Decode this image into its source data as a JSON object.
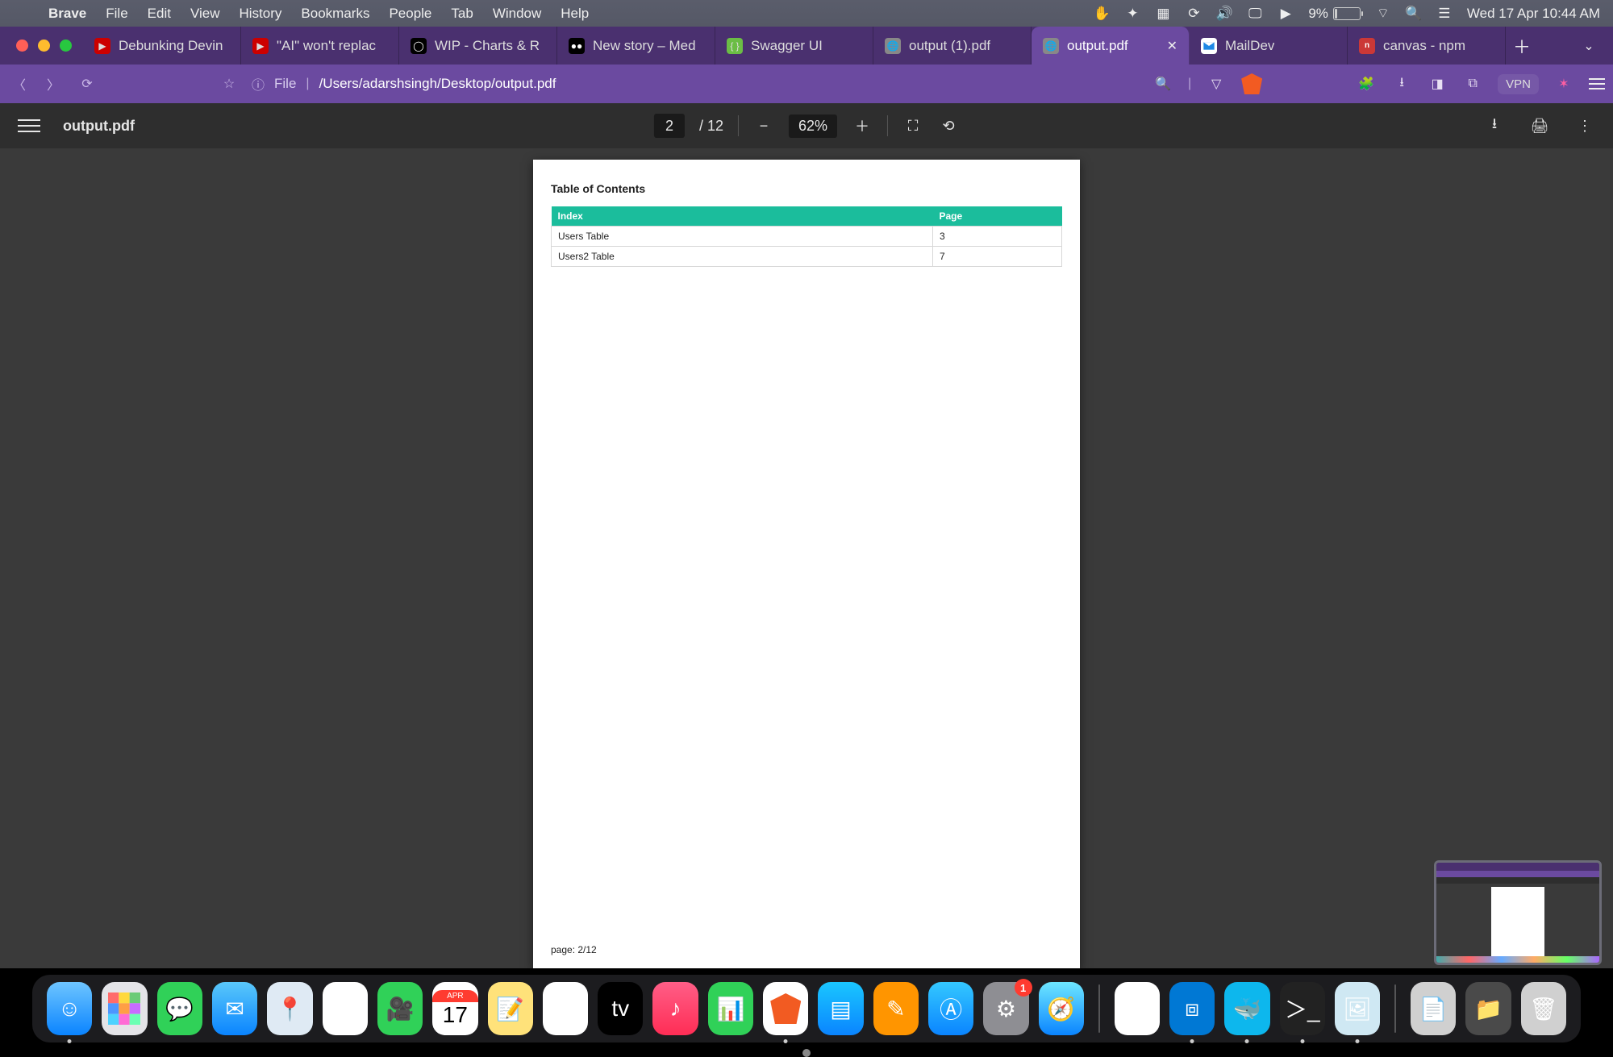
{
  "menubar": {
    "apple": "",
    "app": "Brave",
    "items": [
      "File",
      "Edit",
      "View",
      "History",
      "Bookmarks",
      "People",
      "Tab",
      "Window",
      "Help"
    ],
    "battery_pct": "9%",
    "clock": "Wed 17 Apr  10:44 AM"
  },
  "tabs": [
    {
      "label": "Debunking Devin",
      "favicon": "f-yt"
    },
    {
      "label": "\"AI\" won't replac",
      "favicon": "f-yt"
    },
    {
      "label": "WIP - Charts & R",
      "favicon": "f-gh"
    },
    {
      "label": "New story – Med",
      "favicon": "f-md"
    },
    {
      "label": "Swagger UI",
      "favicon": "f-sw"
    },
    {
      "label": "output (1).pdf",
      "favicon": "f-gl"
    },
    {
      "label": "output.pdf",
      "favicon": "f-gl",
      "active": true
    },
    {
      "label": "MailDev",
      "favicon": "f-ml"
    },
    {
      "label": "canvas - npm",
      "favicon": "f-np"
    }
  ],
  "url": {
    "proto": "File",
    "path": "/Users/adarshsingh/Desktop/output.pdf"
  },
  "vpn_label": "VPN",
  "pdf": {
    "filename": "output.pdf",
    "page_current": "2",
    "page_sep": "/",
    "page_total": "12",
    "zoom": "62%"
  },
  "document": {
    "heading": "Table of Contents",
    "columns": [
      "Index",
      "Page"
    ],
    "rows": [
      {
        "index": "Users Table",
        "page": "3"
      },
      {
        "index": "Users2 Table",
        "page": "7"
      }
    ],
    "footer": "page: 2/12"
  },
  "dock": {
    "badge_settings": "1",
    "calendar_month": "APR",
    "calendar_day": "17"
  }
}
